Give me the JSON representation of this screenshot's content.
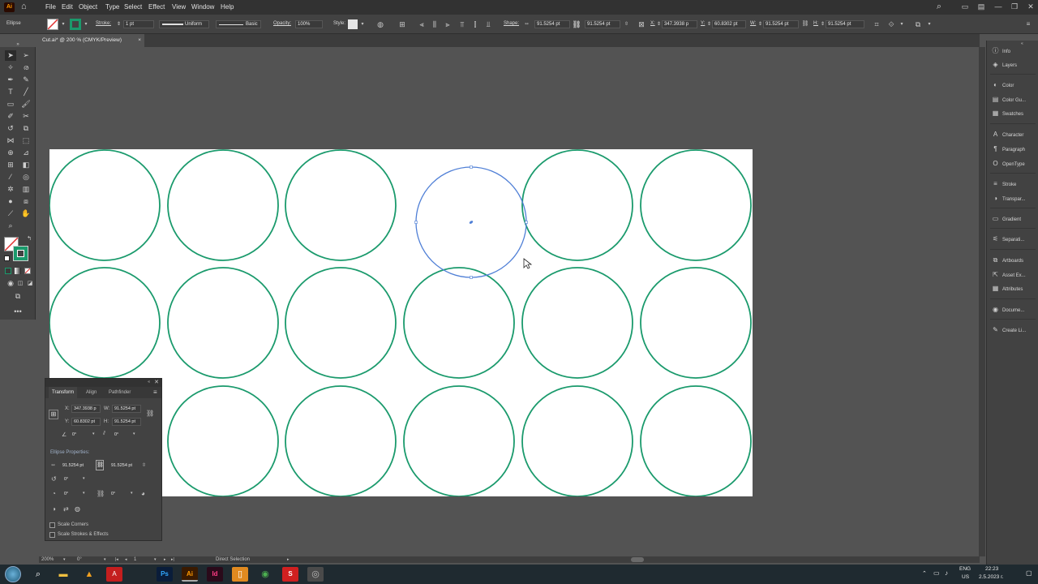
{
  "menubar": {
    "app_logo": "Ai",
    "items": [
      "File",
      "Edit",
      "Object",
      "Type",
      "Select",
      "Effect",
      "View",
      "Window",
      "Help"
    ]
  },
  "control_bar": {
    "object_type": "Ellipse",
    "stroke_label": "Stroke:",
    "stroke_weight": "1 pt",
    "profile": "Uniform",
    "brush": "Basic",
    "opacity_label": "Opacity:",
    "opacity_value": "100%",
    "style_label": "Style:",
    "shape_label": "Shape:",
    "shape_width": "91.5254 pt",
    "shape_height": "91.5254 pt",
    "x_label": "X:",
    "x_value": "347.3938 p",
    "y_label": "Y:",
    "y_value": "60.8302 pt",
    "w_label": "W:",
    "w_value": "91.5254 pt",
    "h_label": "H:",
    "h_value": "91.5254 pt"
  },
  "document_tab": {
    "title": "Cut.ai* @ 200 % (CMYK/Preview)",
    "close": "×"
  },
  "right_panel": {
    "items": [
      {
        "label": "Info",
        "icon": "info-icon"
      },
      {
        "label": "Layers",
        "icon": "layers-icon"
      },
      {
        "label": "Color",
        "icon": "color-icon"
      },
      {
        "label": "Color Gu...",
        "icon": "color-guide-icon"
      },
      {
        "label": "Swatches",
        "icon": "swatches-icon"
      },
      {
        "label": "Character",
        "icon": "character-icon"
      },
      {
        "label": "Paragraph",
        "icon": "paragraph-icon"
      },
      {
        "label": "OpenType",
        "icon": "opentype-icon"
      },
      {
        "label": "Stroke",
        "icon": "stroke-icon"
      },
      {
        "label": "Transpar...",
        "icon": "transparency-icon"
      },
      {
        "label": "Gradient",
        "icon": "gradient-icon"
      },
      {
        "label": "Separati...",
        "icon": "separations-icon"
      },
      {
        "label": "Artboards",
        "icon": "artboards-icon"
      },
      {
        "label": "Asset Ex...",
        "icon": "asset-export-icon"
      },
      {
        "label": "Attributes",
        "icon": "attributes-icon"
      },
      {
        "label": "Docume...",
        "icon": "document-info-icon"
      },
      {
        "label": "Create Li...",
        "icon": "create-link-icon"
      }
    ]
  },
  "transform_panel": {
    "tabs": [
      "Transform",
      "Align",
      "Pathfinder"
    ],
    "x_label": "X:",
    "x_value": "347.3938 p",
    "y_label": "Y:",
    "y_value": "60.8302 pt",
    "w_label": "W:",
    "w_value": "91.5254 pt",
    "h_label": "H:",
    "h_value": "91.5254 pt",
    "angle_value": "0°",
    "shear_value": "0°",
    "ellipse_properties_label": "Ellipse Properties:",
    "ellipse_width": "91.5254 pt",
    "ellipse_height": "91.5254 pt",
    "rotation_value": "0°",
    "pie_start": "0°",
    "pie_end": "0°",
    "scale_corners_label": "Scale Corners",
    "scale_strokes_label": "Scale Strokes & Effects"
  },
  "status_bar": {
    "zoom": "200%",
    "rotation": "0°",
    "artboard_number": "1",
    "current_tool": "Direct Selection"
  },
  "taskbar": {
    "language": "ENG",
    "region": "US",
    "time": "22:23",
    "date": "2.5.2023 г."
  },
  "colors": {
    "stroke_green": "#1a9a6c",
    "selection_blue": "#4f7fd6",
    "artboard": "#ffffff",
    "workspace": "#535353"
  },
  "canvas": {
    "circles": [
      {
        "row": 0,
        "col": 0
      },
      {
        "row": 0,
        "col": 1
      },
      {
        "row": 0,
        "col": 2
      },
      {
        "row": 0,
        "col": 3,
        "selected": true
      },
      {
        "row": 0,
        "col": 4
      },
      {
        "row": 0,
        "col": 5
      },
      {
        "row": 1,
        "col": 0
      },
      {
        "row": 1,
        "col": 1
      },
      {
        "row": 1,
        "col": 2
      },
      {
        "row": 1,
        "col": 3
      },
      {
        "row": 1,
        "col": 4
      },
      {
        "row": 1,
        "col": 5
      },
      {
        "row": 2,
        "col": 0
      },
      {
        "row": 2,
        "col": 1
      },
      {
        "row": 2,
        "col": 2
      },
      {
        "row": 2,
        "col": 3
      },
      {
        "row": 2,
        "col": 4
      },
      {
        "row": 2,
        "col": 5
      }
    ]
  }
}
